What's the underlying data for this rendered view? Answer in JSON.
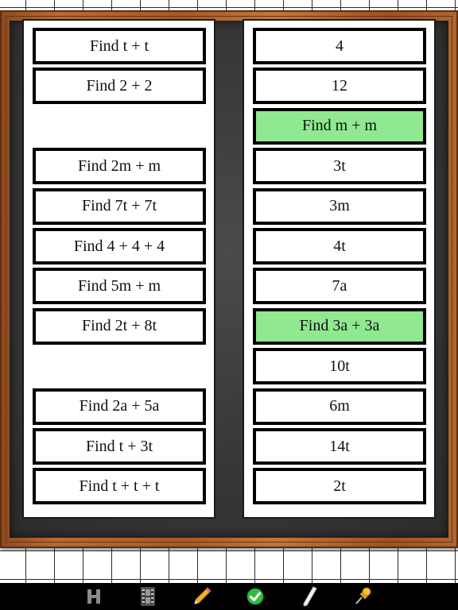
{
  "left_column": {
    "items": [
      {
        "label": "Find t + t",
        "slot": 0
      },
      {
        "label": "Find 2 + 2",
        "slot": 1
      },
      {
        "label": "Find 2m + m",
        "slot": 3
      },
      {
        "label": "Find 7t + 7t",
        "slot": 4
      },
      {
        "label": "Find 4 + 4 + 4",
        "slot": 5
      },
      {
        "label": "Find 5m + m",
        "slot": 6
      },
      {
        "label": "Find 2t + 8t",
        "slot": 7
      },
      {
        "label": "Find 2a + 5a",
        "slot": 9
      },
      {
        "label": "Find t + 3t",
        "slot": 10
      },
      {
        "label": "Find t + t + t",
        "slot": 11
      }
    ]
  },
  "right_column": {
    "items": [
      {
        "label": "4",
        "highlighted": false
      },
      {
        "label": "12",
        "highlighted": false
      },
      {
        "label": "Find m + m",
        "highlighted": true
      },
      {
        "label": "3t",
        "highlighted": false
      },
      {
        "label": "3m",
        "highlighted": false
      },
      {
        "label": "4t",
        "highlighted": false
      },
      {
        "label": "7a",
        "highlighted": false
      },
      {
        "label": "Find 3a + 3a",
        "highlighted": true
      },
      {
        "label": "10t",
        "highlighted": false
      },
      {
        "label": "6m",
        "highlighted": false
      },
      {
        "label": "14t",
        "highlighted": false
      },
      {
        "label": "2t",
        "highlighted": false
      }
    ]
  },
  "toolbar": {
    "tools": [
      {
        "name": "hint-h-icon"
      },
      {
        "name": "film-strip-icon"
      },
      {
        "name": "pencil-icon"
      },
      {
        "name": "check-icon"
      },
      {
        "name": "chalk-icon"
      },
      {
        "name": "pushpin-icon"
      }
    ]
  },
  "colors": {
    "highlight": "#90e890",
    "board": "#363636",
    "frame": "#b06430"
  }
}
